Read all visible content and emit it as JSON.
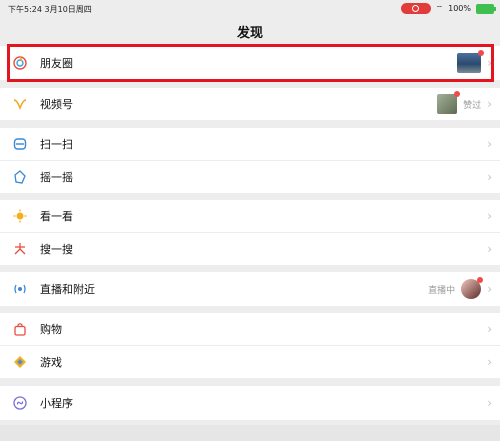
{
  "status_bar": {
    "time": "下午5:24",
    "date": "3月10日周四",
    "battery": "100%"
  },
  "page": {
    "title": "发现"
  },
  "rows": {
    "moments": {
      "label": "朋友圈",
      "icon": "moments-icon"
    },
    "channels": {
      "label": "视频号",
      "side": "赞过",
      "icon": "channels-icon"
    },
    "scan": {
      "label": "扫一扫",
      "icon": "scan-icon"
    },
    "shake": {
      "label": "摇一摇",
      "icon": "shake-icon"
    },
    "top_stories": {
      "label": "看一看",
      "icon": "top-stories-icon"
    },
    "search": {
      "label": "搜一搜",
      "icon": "search-icon"
    },
    "live_nearby": {
      "label": "直播和附近",
      "side": "直播中",
      "icon": "live-icon"
    },
    "shopping": {
      "label": "购物",
      "icon": "shopping-icon"
    },
    "games": {
      "label": "游戏",
      "icon": "game-icon"
    },
    "mini_programs": {
      "label": "小程序",
      "icon": "mini-program-icon"
    }
  },
  "colors": {
    "highlight": "#e3161f",
    "background": "#ededed",
    "badge": "#f04b4b"
  }
}
